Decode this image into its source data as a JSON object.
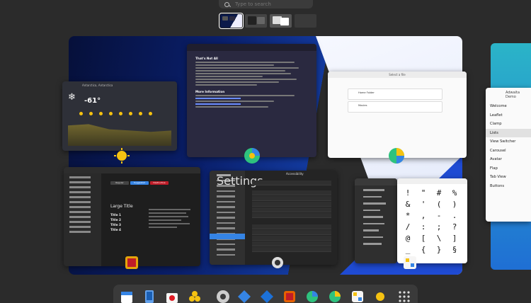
{
  "search": {
    "placeholder": "Type to search"
  },
  "weather": {
    "location": "Antarctica, Antarctica",
    "temperature": "-61°"
  },
  "article": {
    "heading1": "That's Not All",
    "heading2": "More Information"
  },
  "dialog": {
    "title": "Select a file",
    "item1": "Home Folder",
    "item2": "Movies"
  },
  "adw": {
    "buttons": [
      "Regular",
      "Suggested",
      "Destructive"
    ],
    "title": "Large Title",
    "titles": [
      "Title 1",
      "Title 2",
      "Title 3",
      "Title 4"
    ]
  },
  "settings": {
    "title": "Settings",
    "panel": "Accessibility"
  },
  "characters": {
    "glyphs": [
      "!",
      "\"",
      "#",
      "%",
      "&",
      "'",
      "(",
      ")",
      "*",
      ",",
      "-",
      ".",
      "/",
      ":",
      ";",
      "?",
      "@",
      "[",
      "\\",
      "]",
      "_",
      "{",
      "}",
      "§"
    ]
  },
  "libadwaita_list": {
    "title": "Adwaita Demo",
    "items": [
      "Welcome",
      "Leaflet",
      "Clamp",
      "Lists",
      "View Switcher",
      "Carousel",
      "Avatar",
      "Flap",
      "Tab View",
      "Buttons"
    ],
    "selected_index": 3
  },
  "dock": {
    "apps": [
      "calendar-icon",
      "phone-icon",
      "software-icon",
      "extensions-icon",
      "settings-gear-icon",
      "builder-icon",
      "builder-alt-icon",
      "image-viewer-icon",
      "web-browser-icon",
      "disk-usage-icon",
      "characters-icon",
      "weather-icon",
      "show-apps-icon"
    ]
  },
  "colors": {
    "accent": "#3584e4",
    "wallpaper_dark": "#0a1f6b",
    "destructive": "#c01c28",
    "weather_sun": "#f5c211"
  }
}
